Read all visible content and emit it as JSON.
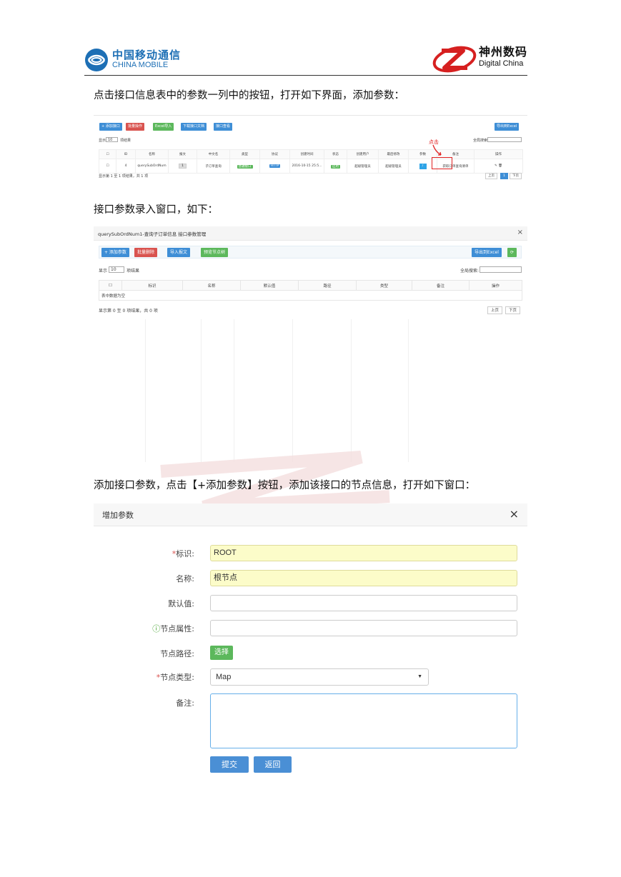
{
  "header": {
    "left_logo_cn": "中国移动通信",
    "left_logo_en": "CHINA MOBILE",
    "right_logo_cn": "神州数码",
    "right_logo_en": "Digital China"
  },
  "paragraphs": {
    "p1": "点击接口信息表中的参数一列中的按钮，打开如下界面，添加参数：",
    "p2": "接口参数录入窗口，如下：",
    "p3": "添加接口参数，点击【+添加参数】按钮，添加该接口的节点信息，打开如下窗口："
  },
  "shot1": {
    "toolbar": [
      "+ 添加接口",
      "批量操作",
      "Excel导入",
      "下载接口文档",
      "接口查看"
    ],
    "export_button": "导出到Excel",
    "show_prefix": "显示",
    "page_size": "10",
    "show_suffix": "项结果",
    "search_label": "全局搜索:",
    "columns": [
      "",
      "ID",
      "名称",
      "报文",
      "中文名",
      "类型",
      "协议",
      "创建时间",
      "状态",
      "创建用户",
      "最后修改",
      "参数",
      "备注",
      "操作"
    ],
    "row": {
      "id": "4",
      "name": "querySubOrdNum",
      "report": "1",
      "cn_name": "子订单查询",
      "type": "普通接口",
      "protocol": "HTTP",
      "created": "2016-10-15 25:5...",
      "status": "启用",
      "create_user": "超级管理员",
      "last_modify": "超级管理员",
      "param": "/",
      "remark": "获取订单查询清单",
      "ops": "✎ 🗑"
    },
    "info": "显示第 1 至 1 项结果，共 1 项",
    "prev": "上页",
    "page": "1",
    "next": "下页",
    "click_label": "点击"
  },
  "shot2": {
    "title": "querySubOrdNum1-查询子订单信息 接口参数管理",
    "close": "×",
    "toolbar": [
      "+ 添加参数",
      "批量删除",
      "导入报文",
      "预览节点树"
    ],
    "export_button": "导出到Excel",
    "refresh": "⟳",
    "show_prefix": "显示",
    "page_size": "10",
    "show_suffix": "项结果",
    "search_label": "全局搜索:",
    "columns": [
      "",
      "标识",
      "名称",
      "默认值",
      "路径",
      "类型",
      "备注",
      "操作"
    ],
    "empty_text": "表中数据为空",
    "info": "显示第 0 至 0 项结果，共 0 项",
    "prev": "上页",
    "next": "下页"
  },
  "dialog": {
    "title": "增加参数",
    "close": "×",
    "fields": {
      "id_label": "标识:",
      "id_value": "ROOT",
      "name_label": "名称:",
      "name_value": "根节点",
      "default_label": "默认值:",
      "default_value": "",
      "attr_label": "节点属性:",
      "attr_value": "",
      "path_label": "节点路径:",
      "choose_button": "选择",
      "type_label": "节点类型:",
      "type_value": "Map",
      "remark_label": "备注:"
    },
    "submit": "提交",
    "back": "返回"
  },
  "colors": {
    "brand_blue": "#1d6fb5",
    "danger": "#d9534f",
    "success": "#5cb85c",
    "primary": "#3e8ed6",
    "highlight": "#fcfcc9"
  }
}
